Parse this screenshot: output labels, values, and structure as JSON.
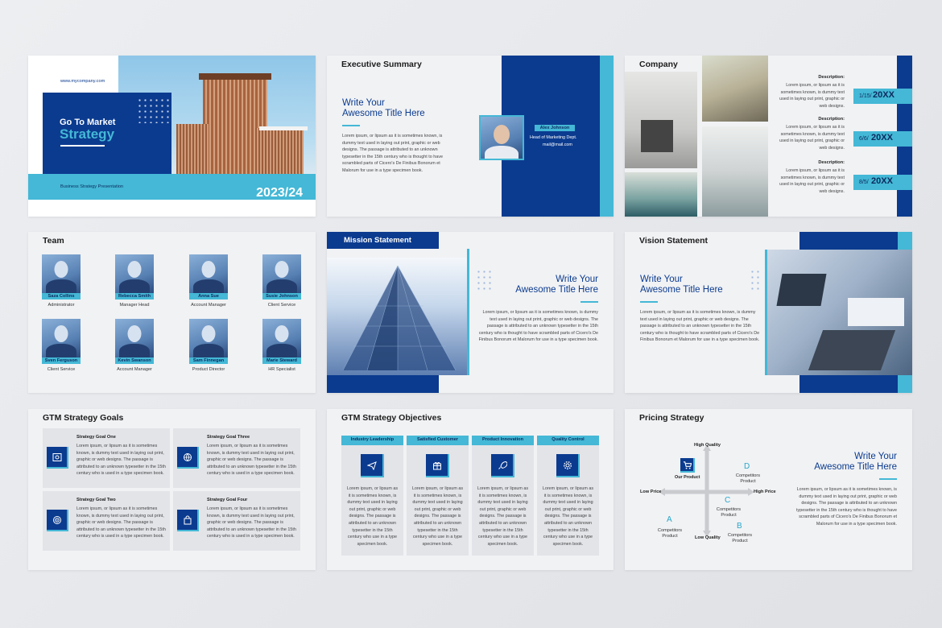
{
  "slide1": {
    "website": "www.mycompany.com",
    "title_line1": "Go To Market",
    "title_line2": "Strategy",
    "subtitle": "Business Strategy Presentation",
    "year": "2023/24"
  },
  "slide2": {
    "heading": "Executive Summary",
    "title_line1": "Write Your",
    "title_line2": "Awesome Title Here",
    "paragraph": "Lorem ipsum, or lipsum as it is sometimes known, is dummy text used in laying out print, graphic or web designs. The passage is attributed to an unknown typesetter in the 15th century who is thought to have scrambled parts of Cicero's De Finibus Bonorum et Malorum for use in a type specimen book.",
    "person_name": "Alex Johnson",
    "person_role": "Head of Marketing Dept.",
    "person_email": "mail@mail.com"
  },
  "slide3": {
    "heading": "Company",
    "items": [
      {
        "label": "Description:",
        "text": "Lorem ipsum, or lipsum as it is sometimes known, is dummy text used in laying out print, graphic or web designs.",
        "date": "1/15/",
        "year": "20XX"
      },
      {
        "label": "Description:",
        "text": "Lorem ipsum, or lipsum as it is sometimes known, is dummy text used in laying out print, graphic or web designs.",
        "date": "6/6/",
        "year": "20XX"
      },
      {
        "label": "Description:",
        "text": "Lorem ipsum, or lipsum as it is sometimes known, is dummy text used in laying out print, graphic or web designs.",
        "date": "8/5/",
        "year": "20XX"
      }
    ]
  },
  "slide4": {
    "heading": "Team",
    "members": [
      {
        "name": "Saza Collins",
        "role": "Administrator"
      },
      {
        "name": "Rebecca Smith",
        "role": "Manager Head"
      },
      {
        "name": "Anna Sue",
        "role": "Account Manager"
      },
      {
        "name": "Susie Johnson",
        "role": "Client Service"
      },
      {
        "name": "Sven Ferguson",
        "role": "Client Service"
      },
      {
        "name": "Kevin Swanson",
        "role": "Account Manager"
      },
      {
        "name": "Sam Finnegan",
        "role": "Product Director"
      },
      {
        "name": "Marie Steward",
        "role": "HR Specialist"
      }
    ]
  },
  "slide5": {
    "heading": "Mission Statement",
    "title_line1": "Write Your",
    "title_line2": "Awesome Title Here",
    "paragraph": "Lorem ipsum, or lipsum as it is sometimes known, is dummy text used in laying out print, graphic or web designs. The passage is attributed to an unknown typesetter in the 15th century who is thought to have scrambled parts of Cicero's De Finibus Bonorum et Malorum for use in a type specimen book."
  },
  "slide6": {
    "heading": "Vision Statement",
    "title_line1": "Write Your",
    "title_line2": "Awesome Title Here",
    "paragraph": "Lorem ipsum, or lipsum as it is sometimes known, is dummy text used in laying out print, graphic or web designs. The passage is attributed to an unknown typesetter in the 15th century who is thought to have scrambled parts of Cicero's De Finibus Bonorum et Malorum for use in a type specimen book."
  },
  "slide7": {
    "heading": "GTM Strategy Goals",
    "goals": [
      {
        "title": "Strategy Goal One",
        "text": "Lorem ipsum, or lipsum as it is sometimes known, is dummy text used in laying out print, graphic or web designs. The passage is attributed to an unknown typesetter in the 15th century who is used in a type specimen book.",
        "icon": "safe-icon"
      },
      {
        "title": "Strategy Goal Three",
        "text": "Lorem ipsum, or lipsum as it is sometimes known, is dummy text used in laying out print, graphic or web designs. The passage is attributed to an unknown typesetter in the 15th century who is used in a type specimen book.",
        "icon": "globe-icon"
      },
      {
        "title": "Strategy Goal Two",
        "text": "Lorem ipsum, or lipsum as it is sometimes known, is dummy text used in laying out print, graphic or web designs. The passage is attributed to an unknown typesetter in the 15th century who is used in a type specimen book.",
        "icon": "target-icon"
      },
      {
        "title": "Strategy Goal Four",
        "text": "Lorem ipsum, or lipsum as it is sometimes known, is dummy text used in laying out print, graphic or web designs. The passage is attributed to an unknown typesetter in the 15th century who is used in a type specimen book.",
        "icon": "shopping-bag-icon"
      }
    ]
  },
  "slide8": {
    "heading": "GTM Strategy Objectives",
    "objectives": [
      {
        "title": "Industry Leadership",
        "text": "Lorem ipsum, or lipsum as it is sometimes known, is dummy text used in laying out print, graphic or web designs. The passage is attributed to an unknown typesetter in the 15th century who use in a type specimen book.",
        "icon": "paper-plane-icon"
      },
      {
        "title": "Satisfied Customer",
        "text": "Lorem ipsum, or lipsum as it is sometimes known, is dummy text used in laying out print, graphic or web designs. The passage is attributed to an unknown typesetter in the 15th century who use in a type specimen book.",
        "icon": "gift-box-icon"
      },
      {
        "title": "Product Innovation",
        "text": "Lorem ipsum, or lipsum as it is sometimes known, is dummy text used in laying out print, graphic or web designs. The passage is attributed to an unknown typesetter in the 15th century who use in a type specimen book.",
        "icon": "rocket-icon"
      },
      {
        "title": "Quality Control",
        "text": "Lorem ipsum, or lipsum as it is sometimes known, is dummy text used in laying out print, graphic or web designs. The passage is attributed to an unknown typesetter in the 15th century who use in a type specimen book.",
        "icon": "gear-icon"
      }
    ]
  },
  "slide9": {
    "heading": "Pricing Strategy",
    "high_quality": "High Quality",
    "low_quality": "Low Quality",
    "low_price": "Low Price",
    "high_price": "High Price",
    "our_product": "Our Product",
    "competitor_a_letter": "A",
    "competitor_a_label": "Competitors Product",
    "competitor_b_letter": "B",
    "competitor_b_label": "Competitors Product",
    "competitor_c_letter": "C",
    "competitor_c_label": "Competitors Product",
    "competitor_d_letter": "D",
    "competitor_d_label": "Competitors Product",
    "title_line1": "Write Your",
    "title_line2": "Awesome Title Here",
    "paragraph": "Lorem ipsum, or lipsum as it is sometimes known, is dummy text used in laying out print, graphic or web designs. The passage is attributed to an unknown typesetter in the 15th century who is thought to have scrambled parts of Cicero's De Finibus Bonorum et Malorum for use in a type specimen book."
  },
  "colors": {
    "navy": "#0b3b8f",
    "cyan": "#44b8d6",
    "slide_bg": "#f1f2f4"
  }
}
